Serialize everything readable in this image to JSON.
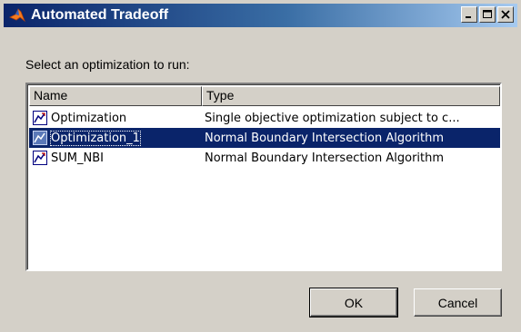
{
  "window": {
    "title": "Automated Tradeoff",
    "icon": "matlab-icon",
    "controls": [
      "minimize-icon",
      "maximize-icon",
      "close-icon"
    ]
  },
  "prompt": "Select an optimization to run:",
  "list": {
    "columns": [
      "Name",
      "Type"
    ],
    "rows": [
      {
        "name": "Optimization",
        "type": "Single objective optimization subject to c...",
        "icon": "optimization-icon",
        "selected": false
      },
      {
        "name": "Optimization_1",
        "type": "Normal Boundary Intersection Algorithm",
        "icon": "optimization-icon",
        "selected": true
      },
      {
        "name": "SUM_NBI",
        "type": "Normal Boundary Intersection Algorithm",
        "icon": "optimization-icon",
        "selected": false
      }
    ]
  },
  "buttons": {
    "ok": "OK",
    "cancel": "Cancel"
  },
  "colors": {
    "titlebar_start": "#0a246a",
    "titlebar_end": "#a6caf0",
    "selection": "#0a246a",
    "face": "#d4d0c8"
  }
}
